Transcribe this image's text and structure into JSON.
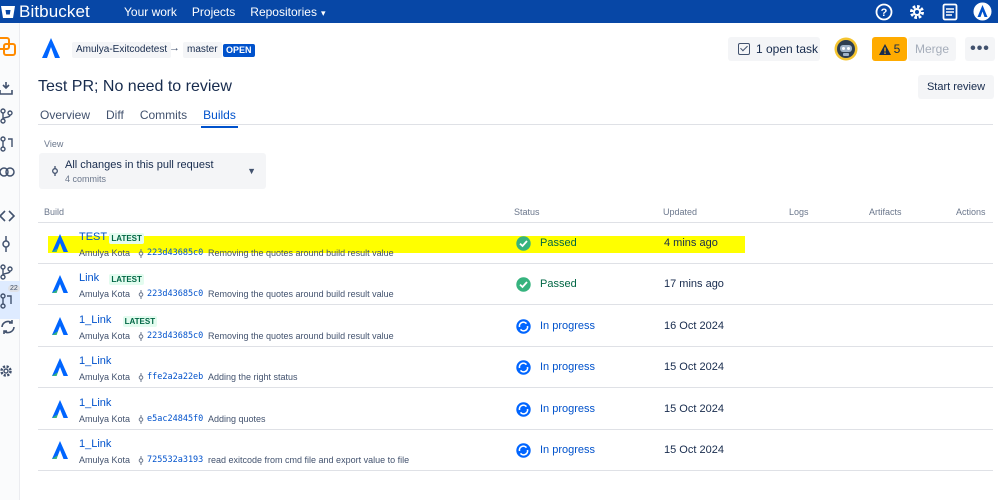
{
  "topbar": {
    "brand": "Bitbucket",
    "nav": [
      "Your work",
      "Projects",
      "Repositories"
    ],
    "icons": [
      "help-icon",
      "settings-icon",
      "notes-icon",
      "profile-avatar"
    ]
  },
  "pr": {
    "source_branch": "Amulya-Exitcodetest",
    "arrow": "→",
    "target_branch": "master",
    "state": "OPEN",
    "open_tasks": "1 open task",
    "warning_count": "5",
    "merge_label": "Merge",
    "more_label": "•••",
    "title": "Test PR; No need to review",
    "start_review_label": "Start review",
    "tabs": [
      {
        "label": "Overview",
        "active": false
      },
      {
        "label": "Diff",
        "active": false
      },
      {
        "label": "Commits",
        "active": false
      },
      {
        "label": "Builds",
        "active": true
      }
    ]
  },
  "view": {
    "label": "View",
    "selected": "All changes in this pull request",
    "sub": "4 commits"
  },
  "table": {
    "headers": {
      "build": "Build",
      "status": "Status",
      "updated": "Updated",
      "logs": "Logs",
      "artifacts": "Artifacts",
      "actions": "Actions"
    },
    "rows": [
      {
        "name": "TEST",
        "latest": "LATEST",
        "author": "Amulya Kota",
        "hash": "223d43685c0",
        "message": "Removing the quotes around build result value",
        "status": "Passed",
        "status_kind": "passed",
        "updated": "4 mins ago"
      },
      {
        "name": "Link",
        "latest": "LATEST",
        "author": "Amulya Kota",
        "hash": "223d43685c0",
        "message": "Removing the quotes around build result value",
        "status": "Passed",
        "status_kind": "passed",
        "updated": "17 mins ago"
      },
      {
        "name": "1_Link",
        "latest": "LATEST",
        "author": "Amulya Kota",
        "hash": "223d43685c0",
        "message": "Removing the quotes around build result value",
        "status": "In progress",
        "status_kind": "progress",
        "updated": "16 Oct 2024"
      },
      {
        "name": "1_Link",
        "latest": "",
        "author": "Amulya Kota",
        "hash": "ffe2a2a22eb",
        "message": "Adding the right status",
        "status": "In progress",
        "status_kind": "progress",
        "updated": "15 Oct 2024"
      },
      {
        "name": "1_Link",
        "latest": "",
        "author": "Amulya Kota",
        "hash": "e5ac24845f0",
        "message": "Adding quotes",
        "status": "In progress",
        "status_kind": "progress",
        "updated": "15 Oct 2024"
      },
      {
        "name": "1_Link",
        "latest": "",
        "author": "Amulya Kota",
        "hash": "725532a3193",
        "message": "read exitcode from cmd file and export value to file",
        "status": "In progress",
        "status_kind": "progress",
        "updated": "15 Oct 2024"
      }
    ]
  },
  "sidebar": {
    "pr_count": "22"
  },
  "colors": {
    "topbar": "#0747a6",
    "link": "#0052cc",
    "passed": "#36b37e",
    "progress": "#0065ff",
    "warning": "#ffab00",
    "highlight": "#ffff00"
  }
}
